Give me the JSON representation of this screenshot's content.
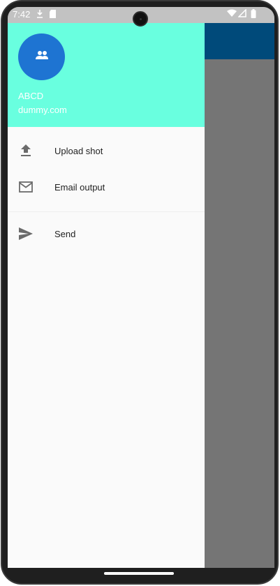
{
  "status_bar": {
    "time": "7:42",
    "icons": [
      "download-icon",
      "sd-card-icon",
      "wifi-icon",
      "signal-icon",
      "battery-icon"
    ]
  },
  "drawer": {
    "header": {
      "background_color": "#69ffdf",
      "avatar_color": "#1e74d2",
      "avatar_icon": "group-icon",
      "name": "ABCD",
      "email": "dummy.com"
    },
    "items": [
      {
        "label": "Upload shot",
        "icon": "upload-icon"
      },
      {
        "label": "Email output",
        "icon": "mail-icon"
      },
      {
        "label": "Send",
        "icon": "send-icon"
      }
    ]
  },
  "app_bar": {
    "color": "#004a7a"
  },
  "scrim_color": "#757575"
}
